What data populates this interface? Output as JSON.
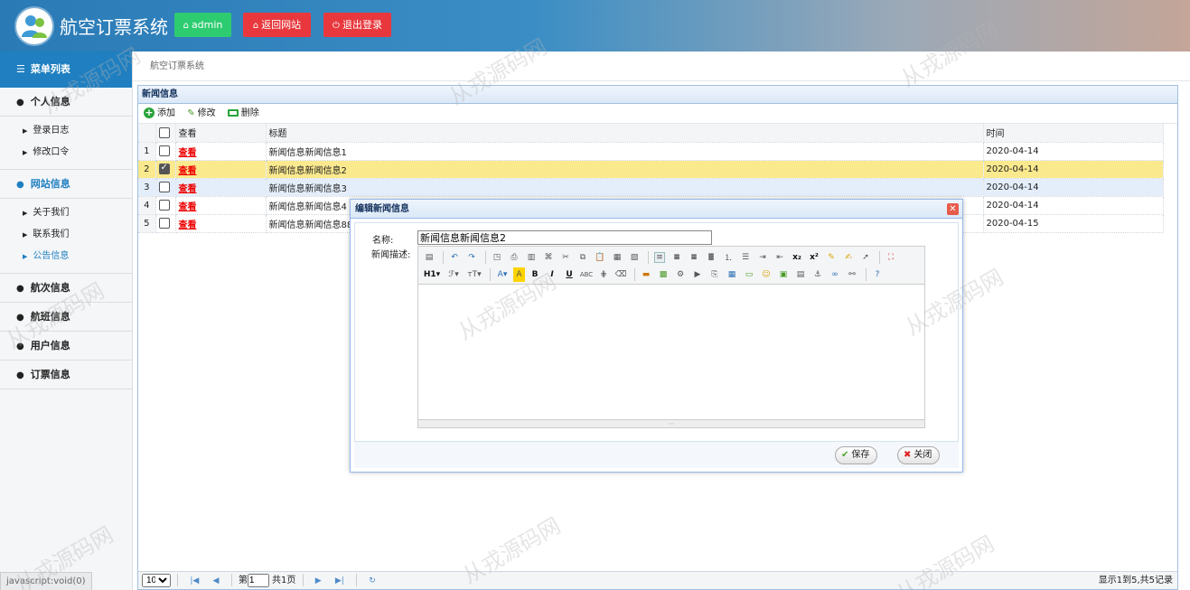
{
  "header": {
    "app_title": "航空订票系统",
    "admin_label": "admin",
    "home_label": "返回网站",
    "logout_label": "退出登录"
  },
  "sidebar": {
    "menu_title": "菜单列表",
    "groups": [
      {
        "label": "个人信息",
        "items": [
          {
            "label": "登录日志"
          },
          {
            "label": "修改口令"
          }
        ]
      },
      {
        "label": "网站信息",
        "items": [
          {
            "label": "关于我们"
          },
          {
            "label": "联系我们"
          },
          {
            "label": "公告信息"
          }
        ]
      },
      {
        "label": "航次信息"
      },
      {
        "label": "航班信息"
      },
      {
        "label": "用户信息"
      },
      {
        "label": "订票信息"
      }
    ]
  },
  "status_url": "javascript:void(0)",
  "breadcrumb": "航空订票系统",
  "panel": {
    "title": "新闻信息",
    "toolbar": {
      "add": "添加",
      "edit": "修改",
      "delete": "删除"
    },
    "columns": {
      "view": "查看",
      "title": "标题",
      "time": "时间"
    },
    "rows": [
      {
        "num": "1",
        "view": "查看",
        "title": "新闻信息新闻信息1",
        "time": "2020-04-14"
      },
      {
        "num": "2",
        "view": "查看",
        "title": "新闻信息新闻信息2",
        "time": "2020-04-14"
      },
      {
        "num": "3",
        "view": "查看",
        "title": "新闻信息新闻信息3",
        "time": "2020-04-14"
      },
      {
        "num": "4",
        "view": "查看",
        "title": "新闻信息新闻信息4",
        "time": "2020-04-14"
      },
      {
        "num": "5",
        "view": "查看",
        "title": "新闻信息新闻信息88",
        "time": "2020-04-15"
      }
    ]
  },
  "pager": {
    "page_size": "10",
    "page_prefix": "第",
    "page_value": "1",
    "page_total": "共1页",
    "info": "显示1到5,共5记录"
  },
  "dialog": {
    "title": "编辑新闻信息",
    "name_label": "名称:",
    "name_value": "新闻信息新闻信息2",
    "desc_label": "新闻描述:",
    "save_label": "保存",
    "close_label": "关闭"
  },
  "watermark": "从戎源码网"
}
